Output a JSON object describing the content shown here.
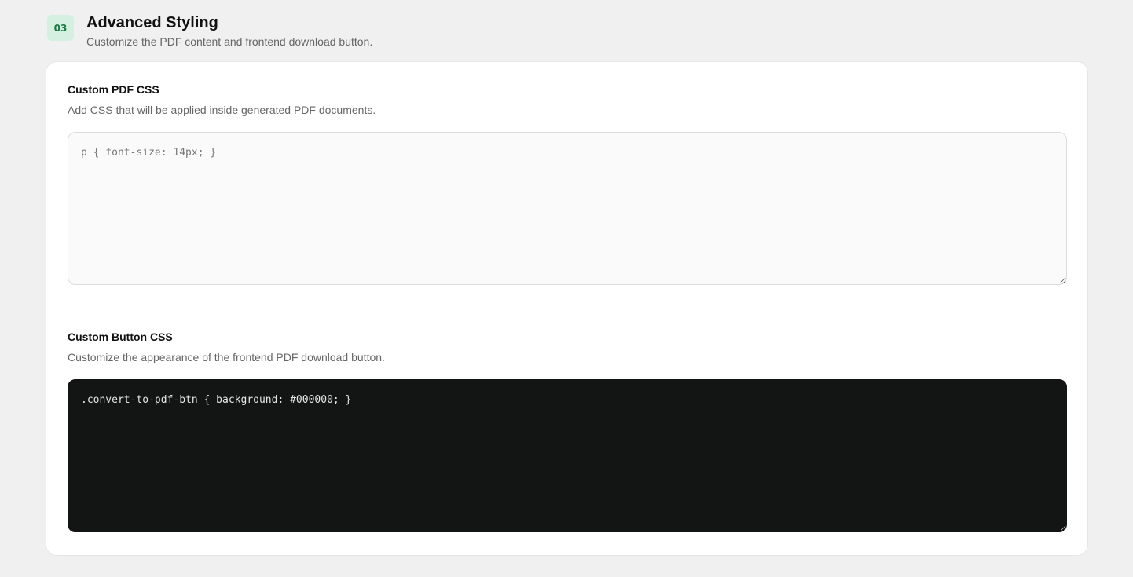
{
  "section": {
    "step": "03",
    "title": "Advanced Styling",
    "subtitle": "Customize the PDF content and frontend download button."
  },
  "pdf_css": {
    "label": "Custom PDF CSS",
    "description": "Add CSS that will be applied inside generated PDF documents.",
    "value": "",
    "placeholder": "p { font-size: 14px; }"
  },
  "button_css": {
    "label": "Custom Button CSS",
    "description": "Customize the appearance of the frontend PDF download button.",
    "value": ".convert-to-pdf-btn { background: #000000; }"
  },
  "colors": {
    "badge_bg": "#d5efe0",
    "badge_text": "#1d7a45",
    "dark_editor_bg": "#131414"
  }
}
